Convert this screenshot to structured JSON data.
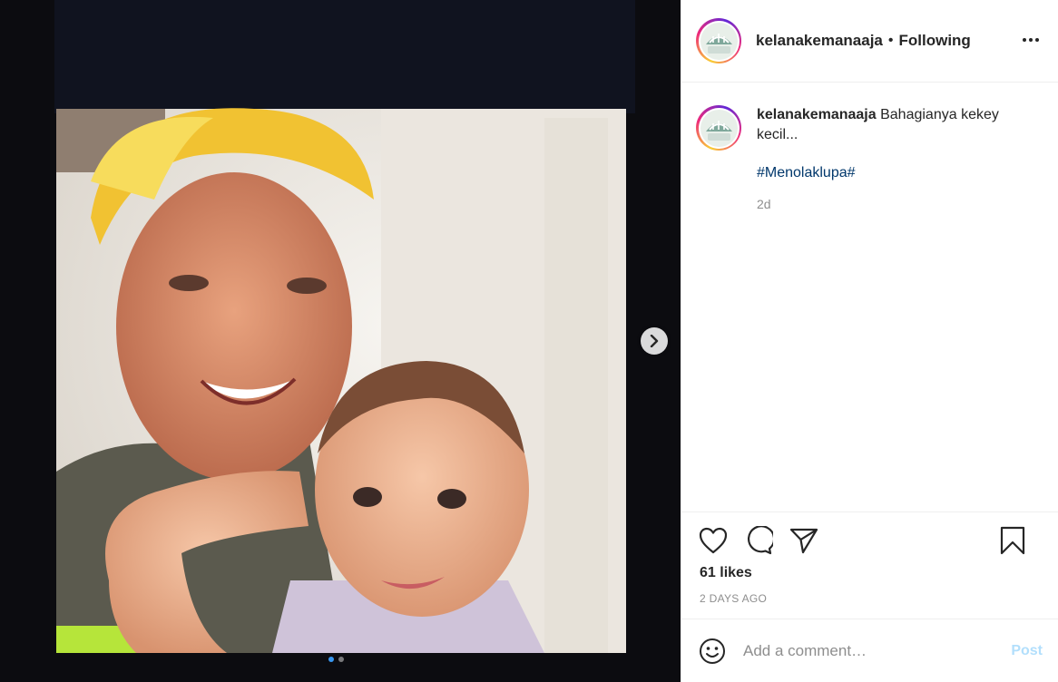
{
  "post": {
    "username": "kelanakemanaaja",
    "separator": "•",
    "follow_status": "Following",
    "more_icon": "more-horizontal-icon"
  },
  "caption": {
    "username": "kelanakemanaaja",
    "text": "Bahagianya kekey kecil...",
    "hashtag": "#Menolaklupa#",
    "age": "2d"
  },
  "actions": {
    "icons": [
      "heart-icon",
      "comment-icon",
      "share-icon",
      "bookmark-icon"
    ],
    "likes": "61 likes",
    "date": "2 DAYS AGO"
  },
  "comment": {
    "placeholder": "Add a comment…",
    "post_label": "Post"
  },
  "carousel": {
    "total": 2,
    "current": 1
  },
  "colors": {
    "link": "#00376b",
    "muted": "#8e8e8e",
    "post_disabled": "#b2dffc",
    "dot_active": "#3897f0"
  }
}
